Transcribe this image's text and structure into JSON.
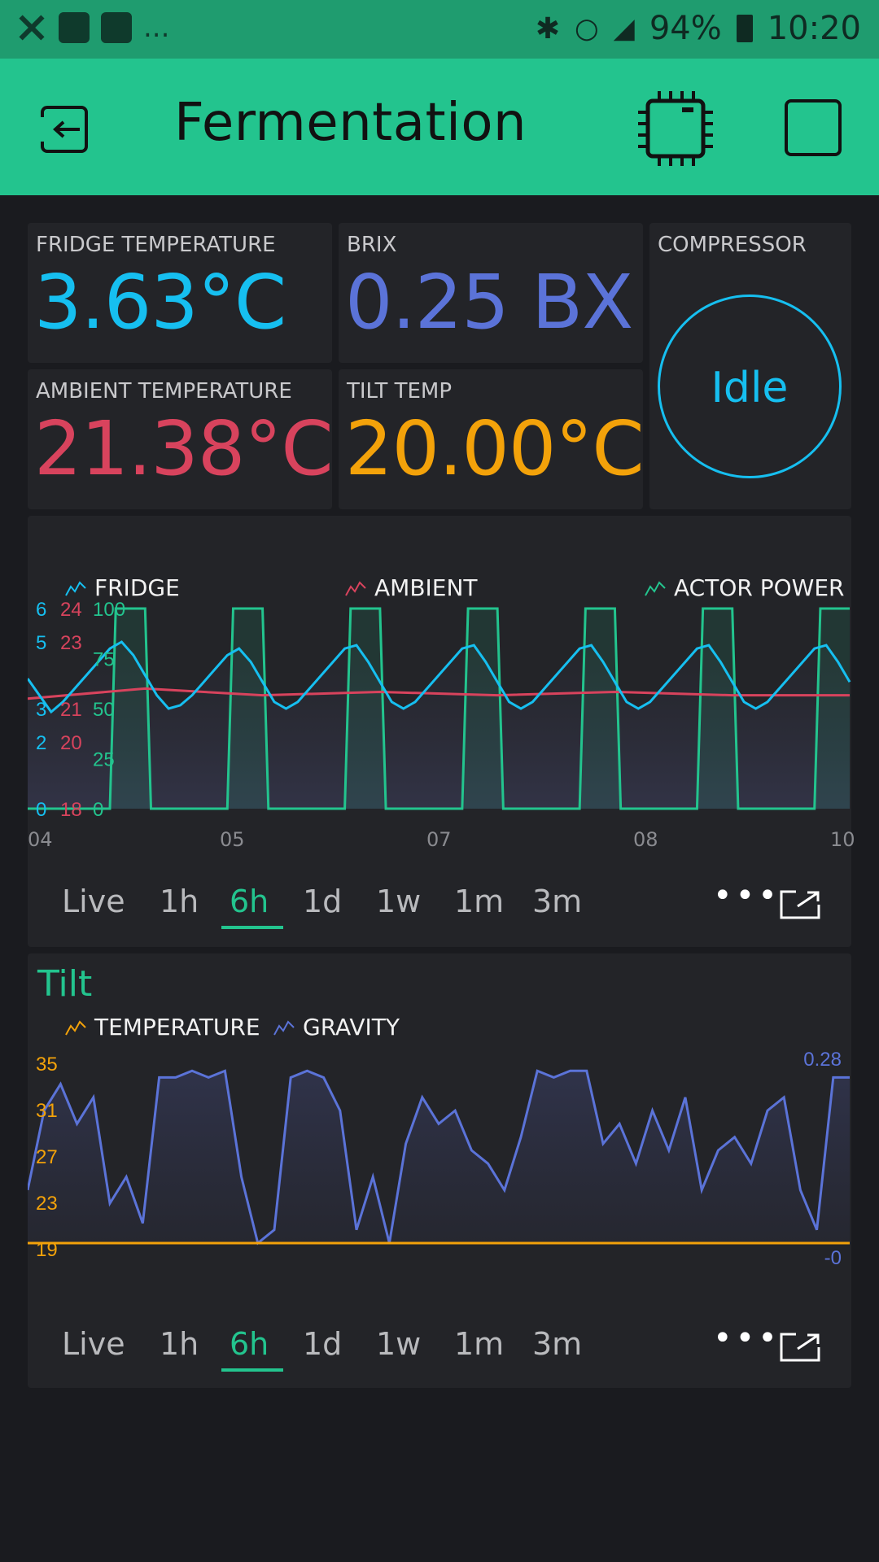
{
  "status_bar": {
    "battery": "94%",
    "time": "10:20",
    "notifications_more": "..."
  },
  "app": {
    "title": "Fermentation"
  },
  "tiles": {
    "fridge_temp": {
      "label": "FRIDGE TEMPERATURE",
      "value": "3.63°C",
      "color": "#16bff0"
    },
    "brix": {
      "label": "BRIX",
      "value": "0.25 BX",
      "color": "#5b73d8"
    },
    "compressor": {
      "label": "COMPRESSOR",
      "state": "Idle",
      "color": "#16bff0"
    },
    "ambient_temp": {
      "label": "AMBIENT TEMPERATURE",
      "value": "21.38°C",
      "color": "#d8435d"
    },
    "tilt_temp": {
      "label": "TILT TEMP",
      "value": "20.00°C",
      "color": "#f3a20a"
    }
  },
  "chart_top": {
    "legend": {
      "fridge": "FRIDGE",
      "ambient": "AMBIENT",
      "actor_power": "ACTOR POWER"
    },
    "tabs": [
      "Live",
      "1h",
      "6h",
      "1d",
      "1w",
      "1m",
      "3m"
    ],
    "active_tab": "6h"
  },
  "chart_tilt": {
    "title": "Tilt",
    "legend": {
      "temperature": "TEMPERATURE",
      "gravity": "GRAVITY"
    },
    "tabs": [
      "Live",
      "1h",
      "6h",
      "1d",
      "1w",
      "1m",
      "3m"
    ],
    "active_tab": "6h"
  },
  "chart_data": [
    {
      "type": "line",
      "x_ticks": [
        "04",
        "05",
        "07",
        "08",
        "10"
      ],
      "series": [
        {
          "name": "FRIDGE",
          "color": "#16bff0",
          "axis_ticks": [
            "0",
            "2",
            "3",
            "5",
            "6"
          ],
          "ylim": [
            0,
            6
          ],
          "x": [
            0,
            1,
            2,
            3,
            4,
            5,
            6,
            7,
            8,
            9,
            10,
            11,
            12,
            13,
            14,
            15,
            16,
            17,
            18,
            19,
            20,
            21,
            22,
            23,
            24,
            25,
            26,
            27,
            28,
            29,
            30,
            31,
            32,
            33,
            34,
            35,
            36,
            37,
            38,
            39,
            40,
            41,
            42,
            43,
            44,
            45,
            46,
            47,
            48,
            49,
            50,
            51,
            52,
            53,
            54,
            55,
            56,
            57,
            58,
            59,
            60,
            61,
            62,
            63,
            64,
            65,
            66,
            67,
            68,
            69,
            70
          ],
          "values": [
            3.9,
            3.4,
            2.9,
            3.2,
            3.6,
            4.0,
            4.4,
            4.8,
            5.0,
            4.6,
            4.0,
            3.4,
            3.0,
            3.1,
            3.4,
            3.8,
            4.2,
            4.6,
            4.8,
            4.4,
            3.8,
            3.2,
            3.0,
            3.2,
            3.6,
            4.0,
            4.4,
            4.8,
            4.9,
            4.4,
            3.8,
            3.2,
            3.0,
            3.2,
            3.6,
            4.0,
            4.4,
            4.8,
            4.9,
            4.4,
            3.8,
            3.2,
            3.0,
            3.2,
            3.6,
            4.0,
            4.4,
            4.8,
            4.9,
            4.4,
            3.8,
            3.2,
            3.0,
            3.2,
            3.6,
            4.0,
            4.4,
            4.8,
            4.9,
            4.4,
            3.8,
            3.2,
            3.0,
            3.2,
            3.6,
            4.0,
            4.4,
            4.8,
            4.9,
            4.4,
            3.8
          ]
        },
        {
          "name": "AMBIENT",
          "color": "#d8435d",
          "axis_ticks": [
            "18",
            "20",
            "21",
            "23",
            "24"
          ],
          "ylim": [
            18,
            24
          ],
          "x": [
            0,
            10,
            20,
            30,
            40,
            50,
            60,
            70
          ],
          "values": [
            21.3,
            21.6,
            21.4,
            21.5,
            21.4,
            21.5,
            21.4,
            21.4
          ]
        },
        {
          "name": "ACTOR POWER",
          "color": "#23c48e",
          "axis_ticks": [
            "0",
            "25",
            "50",
            "75",
            "100"
          ],
          "ylim": [
            0,
            100
          ],
          "x": [
            0,
            7,
            7.5,
            10,
            10.5,
            17,
            17.5,
            20,
            20.5,
            27,
            27.5,
            30,
            30.5,
            37,
            37.5,
            40,
            40.5,
            47,
            47.5,
            50,
            50.5,
            57,
            57.5,
            60,
            60.5,
            67,
            67.5,
            70
          ],
          "values": [
            0,
            0,
            100,
            100,
            0,
            0,
            100,
            100,
            0,
            0,
            100,
            100,
            0,
            0,
            100,
            100,
            0,
            0,
            100,
            100,
            0,
            0,
            100,
            100,
            0,
            0,
            100,
            100
          ]
        }
      ]
    },
    {
      "type": "area",
      "title": "Tilt",
      "series": [
        {
          "name": "TEMPERATURE",
          "color": "#f3a20a",
          "axis_ticks": [
            "19",
            "23",
            "27",
            "31",
            "35"
          ],
          "ylim": [
            19,
            35
          ],
          "x": [
            0,
            100
          ],
          "values": [
            19,
            19
          ]
        },
        {
          "name": "GRAVITY",
          "color": "#5b73d8",
          "axis_ticks": [
            "-0",
            "0.28"
          ],
          "ylim": [
            0,
            0.28
          ],
          "x": [
            0,
            2,
            4,
            6,
            8,
            10,
            12,
            14,
            16,
            18,
            20,
            22,
            24,
            26,
            28,
            30,
            32,
            34,
            36,
            38,
            40,
            42,
            44,
            46,
            48,
            50,
            52,
            54,
            56,
            58,
            60,
            62,
            64,
            66,
            68,
            70,
            72,
            74,
            76,
            78,
            80,
            82,
            84,
            86,
            88,
            90,
            92,
            94,
            96,
            98,
            100
          ],
          "values": [
            0.08,
            0.2,
            0.24,
            0.18,
            0.22,
            0.06,
            0.1,
            0.03,
            0.25,
            0.25,
            0.26,
            0.25,
            0.26,
            0.1,
            0.0,
            0.02,
            0.25,
            0.26,
            0.25,
            0.2,
            0.02,
            0.1,
            0.0,
            0.15,
            0.22,
            0.18,
            0.2,
            0.14,
            0.12,
            0.08,
            0.16,
            0.26,
            0.25,
            0.26,
            0.26,
            0.15,
            0.18,
            0.12,
            0.2,
            0.14,
            0.22,
            0.08,
            0.14,
            0.16,
            0.12,
            0.2,
            0.22,
            0.08,
            0.02,
            0.25,
            0.25
          ]
        }
      ]
    }
  ]
}
